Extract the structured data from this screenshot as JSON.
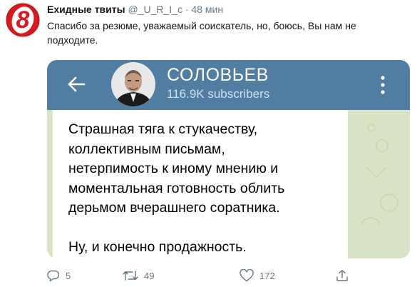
{
  "tweet": {
    "author_name": "Ехидные твиты",
    "author_handle": "@_U_R_I_c",
    "separator": "·",
    "time": "48 мин",
    "text": "Спасибо за резюме, уважаемый соискатель, но, боюсь, Вы нам не подходите.",
    "avatar_icon": "red-number-8-logo",
    "avatar_letter": "8"
  },
  "media": {
    "channel_name": "СОЛОВЬЕВ",
    "subscribers": "116.9K subscribers",
    "back_icon": "back-arrow-icon",
    "menu_icon": "more-vertical-icon",
    "header_color": "#517da2",
    "message": "Страшная тяга к стукачеству,\nколлективным письмам,\nнетерпимость к иному мнению и\nмоментальная готовность облить\nдерьмом вчерашнего соратника.\n\nНу, и конечно продажность."
  },
  "actions": {
    "reply_count": "5",
    "retweet_count": "49",
    "like_count": "172",
    "reply_icon": "reply-icon",
    "retweet_icon": "retweet-icon",
    "like_icon": "heart-icon",
    "share_icon": "share-icon"
  }
}
